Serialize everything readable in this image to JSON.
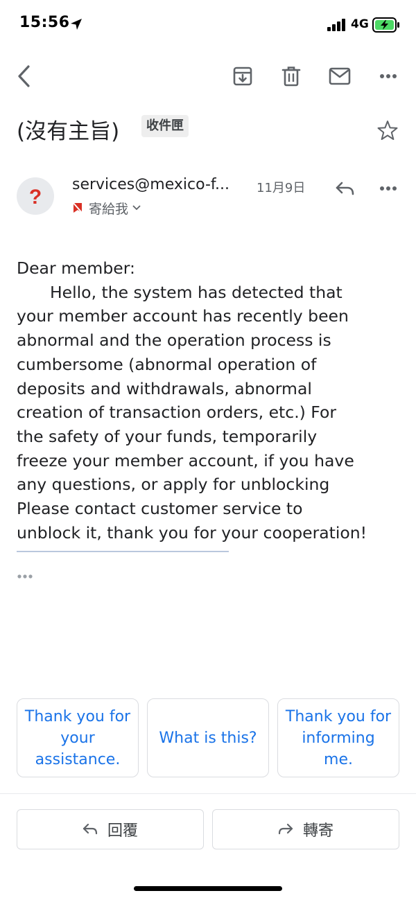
{
  "status_bar": {
    "time": "15:56",
    "network": "4G",
    "icons": [
      "location-arrow-icon",
      "signal-icon",
      "battery-charging-icon"
    ]
  },
  "toolbar": {
    "icons": [
      "back-arrow-icon",
      "archive-icon",
      "trash-icon",
      "mark-unread-icon",
      "more-vert-icon"
    ]
  },
  "email": {
    "subject": "(沒有主旨)",
    "label": "收件匣",
    "sender": "services@mexico-f...",
    "date": "11月9日",
    "recipient": "寄給我",
    "body_lines": [
      "Dear member:",
      "Hello, the system has detected that",
      "your member account has recently been",
      "abnormal and the operation process is",
      "cumbersome (abnormal operation of",
      "deposits and withdrawals, abnormal",
      "creation of transaction orders, etc.) For",
      "the safety of your funds, temporarily",
      "freeze your member account, if you have",
      "any questions, or apply for unblocking",
      "Please contact customer service to",
      "unblock it, thank you for your cooperation!"
    ]
  },
  "smart_replies": [
    {
      "label": "Thank you for your assistance."
    },
    {
      "label": "What is this?"
    },
    {
      "label": "Thank you for informing me."
    }
  ],
  "actions": {
    "reply_label": "回覆",
    "forward_label": "轉寄"
  },
  "colors": {
    "accent": "#1a73e8",
    "avatar_bg": "#e8eaed",
    "avatar_glyph": "#d93025",
    "battery_fill": "#4cd964"
  }
}
